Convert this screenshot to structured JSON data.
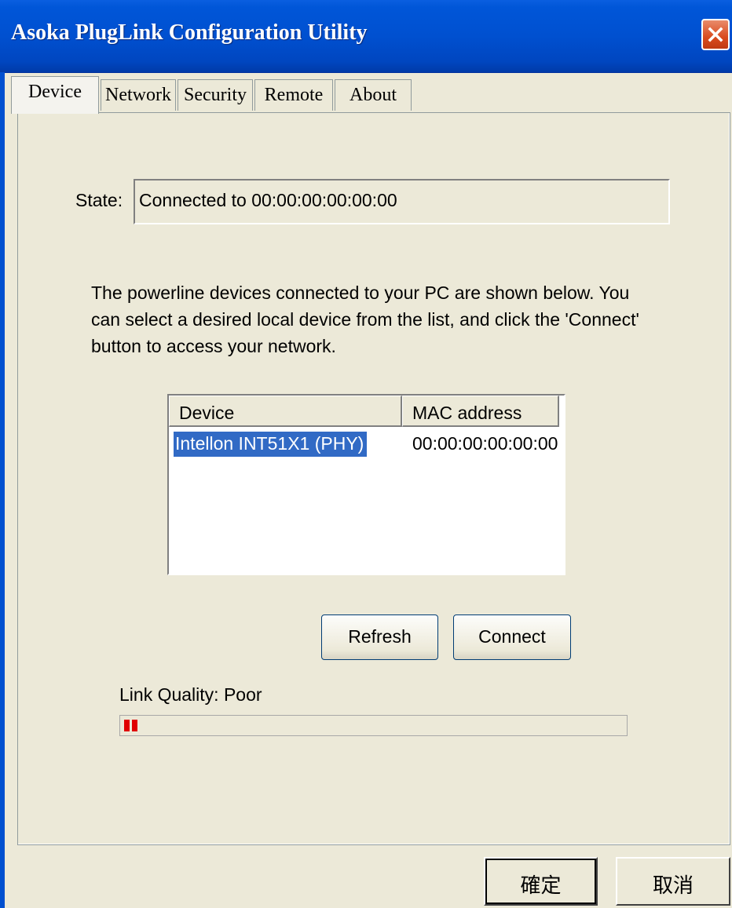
{
  "window": {
    "title": "Asoka PlugLink Configuration Utility"
  },
  "tabs": [
    {
      "label": "Device",
      "active": true
    },
    {
      "label": "Network",
      "active": false
    },
    {
      "label": "Security",
      "active": false
    },
    {
      "label": "Remote",
      "active": false
    },
    {
      "label": "About",
      "active": false
    }
  ],
  "state": {
    "label": "State:",
    "value": "Connected to 00:00:00:00:00:00"
  },
  "description": "The powerline devices connected to your PC are shown below.  You can select a desired local device from the list, and click the 'Connect' button to access your network.",
  "device_list": {
    "columns": [
      "Device",
      "MAC address"
    ],
    "rows": [
      {
        "device": "Intellon INT51X1 (PHY)",
        "mac": "00:00:00:00:00:00",
        "selected": true
      }
    ]
  },
  "buttons": {
    "refresh": "Refresh",
    "connect": "Connect",
    "ok": "確定",
    "cancel": "取消"
  },
  "link_quality": {
    "label": "Link Quality: Poor",
    "level": 0.03,
    "bar_color": "#e00000"
  },
  "colors": {
    "titlebar": "#0050d0",
    "selection": "#316ac5",
    "face": "#ece9d8"
  }
}
